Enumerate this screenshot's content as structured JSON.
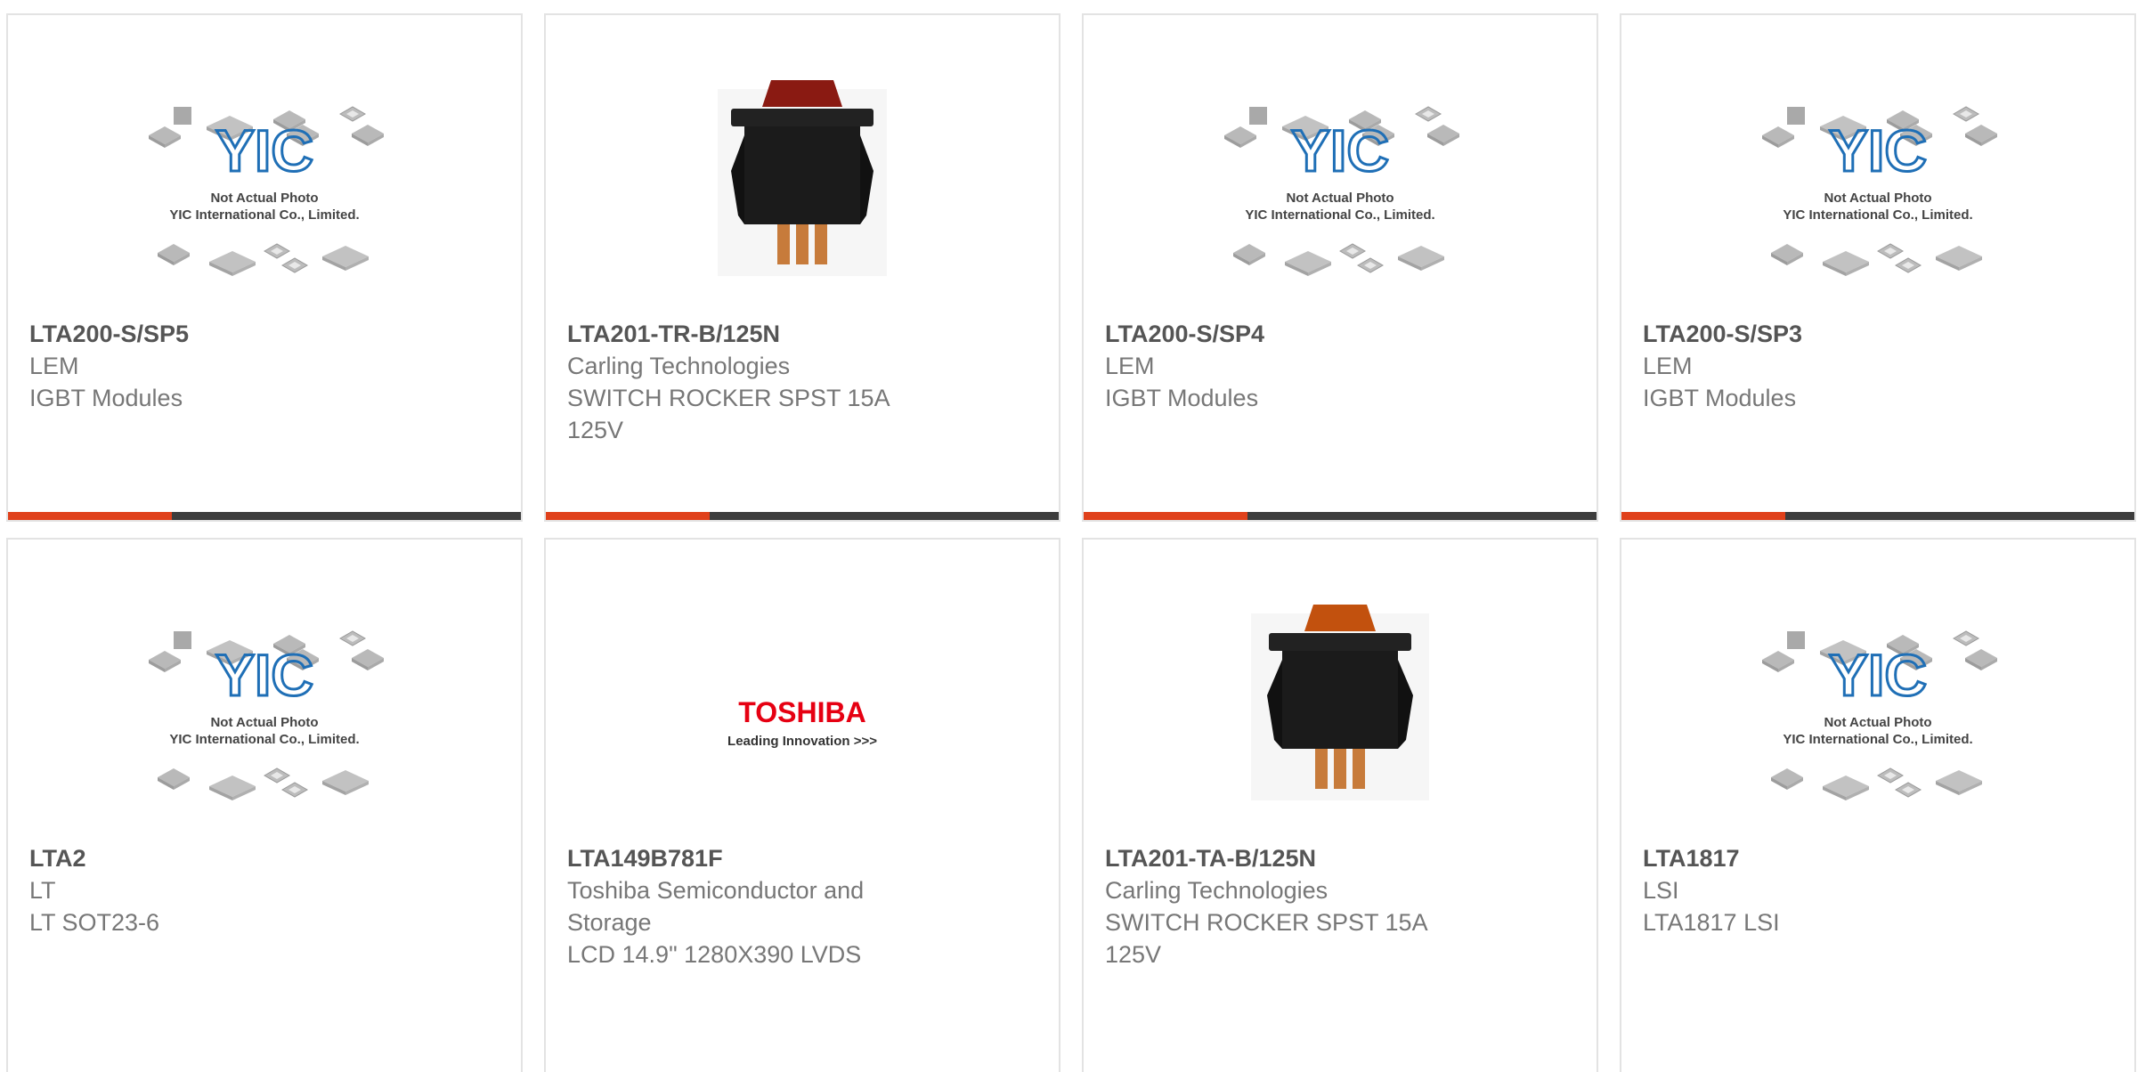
{
  "colors": {
    "accent": "#e0411b",
    "bar": "#3d3d3d",
    "border": "#e3e3e3",
    "yic_blue": "#1f6fb6",
    "toshiba_red": "#e60012"
  },
  "placeholder": {
    "line1": "Not Actual Photo",
    "line2": "YIC International Co., Limited.",
    "logo_text": "YIC"
  },
  "toshiba": {
    "brand": "TOSHIBA",
    "tagline": "Leading Innovation >>>"
  },
  "products": [
    {
      "part": "LTA200-S/SP5",
      "manufacturer": "LEM",
      "desc_line1": "IGBT Modules",
      "desc_line2": "",
      "image": "yic-placeholder",
      "progress": 0.32
    },
    {
      "part": "LTA201-TR-B/125N",
      "manufacturer": "Carling Technologies",
      "desc_line1": "SWITCH ROCKER SPST 15A",
      "desc_line2": "125V",
      "image": "rocker-switch-red",
      "progress": 0.32
    },
    {
      "part": "LTA200-S/SP4",
      "manufacturer": "LEM",
      "desc_line1": "IGBT Modules",
      "desc_line2": "",
      "image": "yic-placeholder",
      "progress": 0.32
    },
    {
      "part": "LTA200-S/SP3",
      "manufacturer": "LEM",
      "desc_line1": "IGBT Modules",
      "desc_line2": "",
      "image": "yic-placeholder",
      "progress": 0.32
    },
    {
      "part": "LTA2",
      "manufacturer": "LT",
      "desc_line1": "LT SOT23-6",
      "desc_line2": "",
      "image": "yic-placeholder",
      "progress": 0
    },
    {
      "part": "LTA149B781F",
      "manufacturer_line1": "Toshiba Semiconductor and",
      "manufacturer_line2": "Storage",
      "desc_line1": "LCD 14.9\" 1280X390 LVDS",
      "desc_line2": "",
      "image": "toshiba-logo",
      "progress": 0
    },
    {
      "part": "LTA201-TA-B/125N",
      "manufacturer": "Carling Technologies",
      "desc_line1": "SWITCH ROCKER SPST 15A",
      "desc_line2": "125V",
      "image": "rocker-switch-amber",
      "progress": 0
    },
    {
      "part": "LTA1817",
      "manufacturer": "LSI",
      "desc_line1": "LTA1817 LSI",
      "desc_line2": "",
      "image": "yic-placeholder",
      "progress": 0
    }
  ]
}
